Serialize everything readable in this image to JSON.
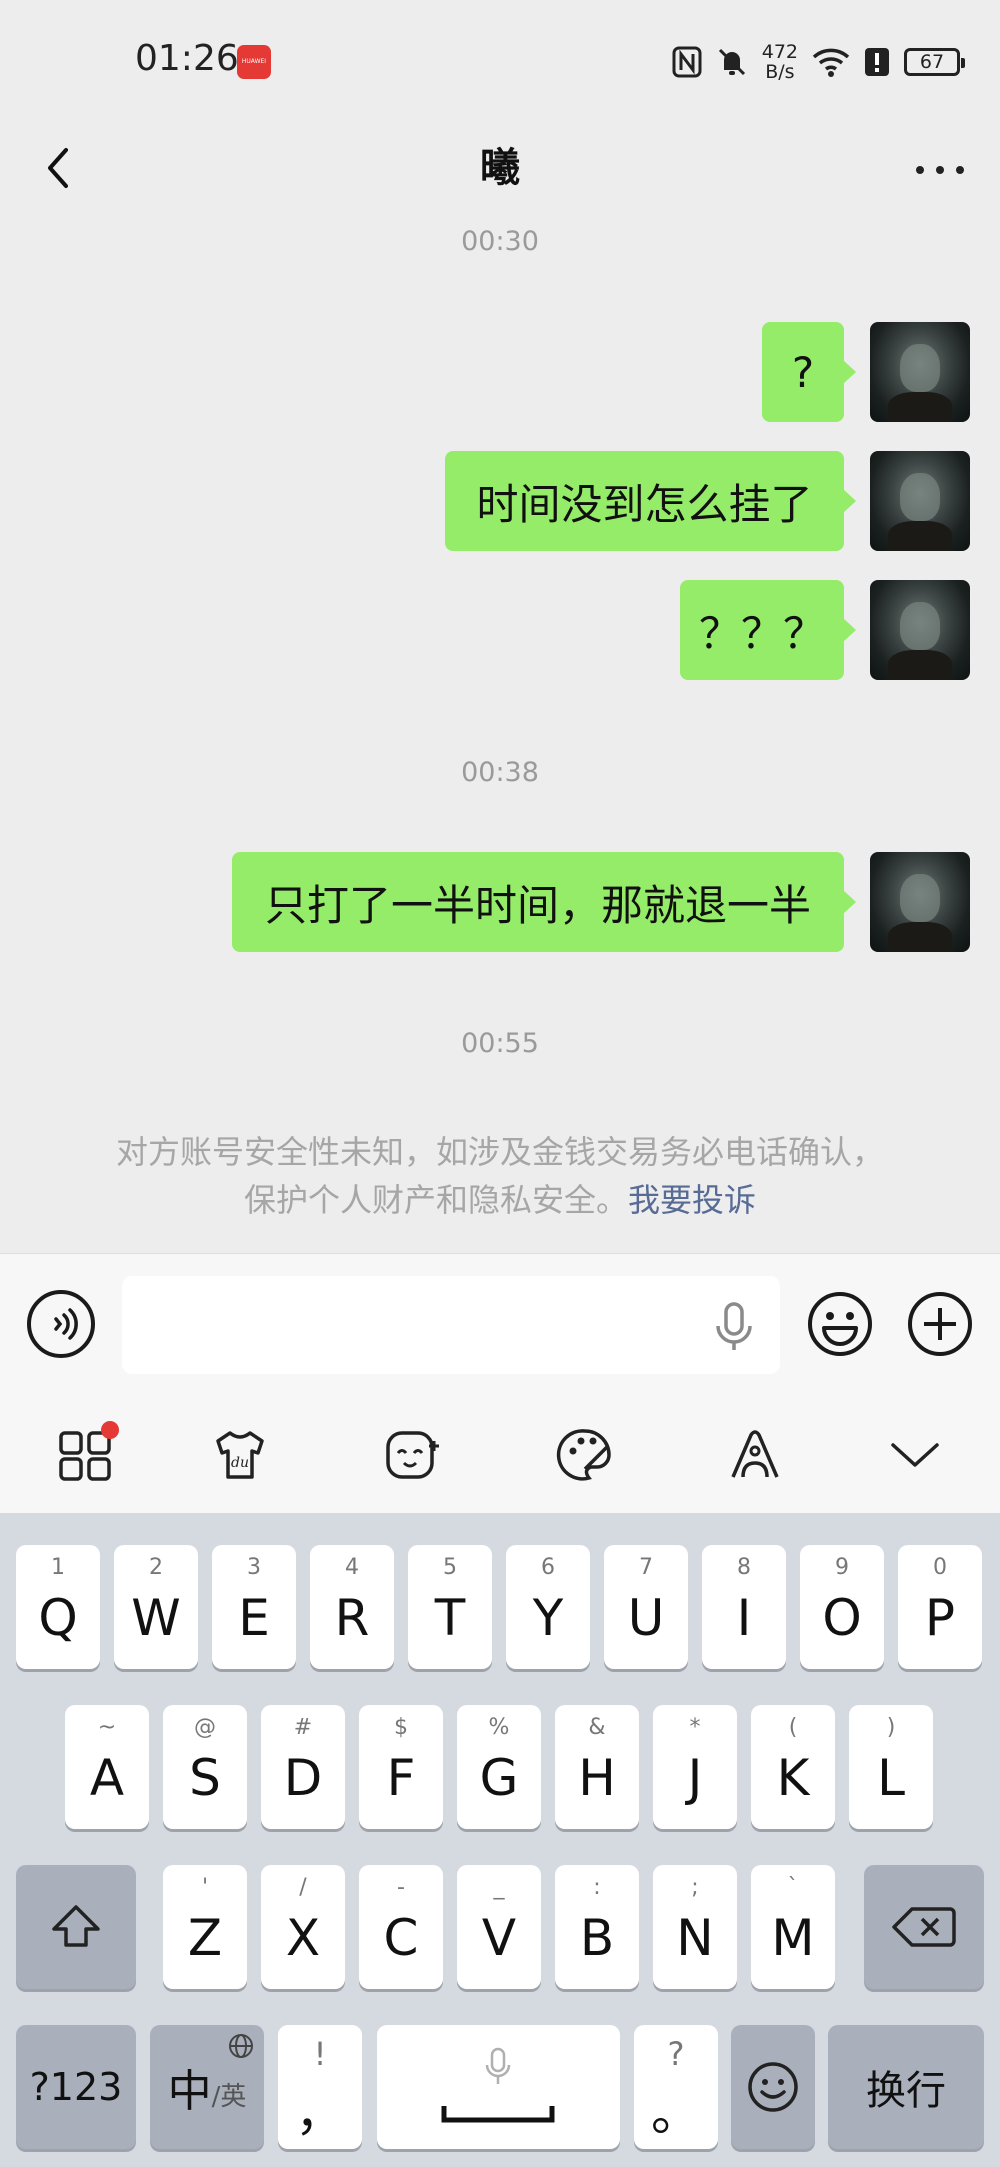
{
  "status_bar": {
    "time": "01:26",
    "app_icon_text": "HUAWEI",
    "net_speed_value": "472",
    "net_speed_unit": "B/s",
    "battery": "67"
  },
  "nav": {
    "title": "曦"
  },
  "messages": [
    {
      "type": "timestamp",
      "text": "00:30"
    },
    {
      "type": "sent",
      "text": "?"
    },
    {
      "type": "sent",
      "text": "时间没到怎么挂了"
    },
    {
      "type": "sent",
      "text": "？？？"
    },
    {
      "type": "timestamp",
      "text": "00:38"
    },
    {
      "type": "sent",
      "text": "只打了一半时间，那就退一半"
    },
    {
      "type": "timestamp",
      "text": "00:55"
    }
  ],
  "notice": {
    "line1": "对方账号安全性未知，如涉及金钱交易务必电话确认，",
    "line2": "保护个人财产和隐私安全。",
    "link": "我要投诉"
  },
  "input": {
    "placeholder": ""
  },
  "keyboard": {
    "row1": [
      {
        "hint": "1",
        "label": "Q"
      },
      {
        "hint": "2",
        "label": "W"
      },
      {
        "hint": "3",
        "label": "E"
      },
      {
        "hint": "4",
        "label": "R"
      },
      {
        "hint": "5",
        "label": "T"
      },
      {
        "hint": "6",
        "label": "Y"
      },
      {
        "hint": "7",
        "label": "U"
      },
      {
        "hint": "8",
        "label": "I"
      },
      {
        "hint": "9",
        "label": "O"
      },
      {
        "hint": "0",
        "label": "P"
      }
    ],
    "row2": [
      {
        "hint": "~",
        "label": "A"
      },
      {
        "hint": "@",
        "label": "S"
      },
      {
        "hint": "#",
        "label": "D"
      },
      {
        "hint": "$",
        "label": "F"
      },
      {
        "hint": "%",
        "label": "G"
      },
      {
        "hint": "&",
        "label": "H"
      },
      {
        "hint": "*",
        "label": "J"
      },
      {
        "hint": "(",
        "label": "K"
      },
      {
        "hint": ")",
        "label": "L"
      }
    ],
    "row3": [
      {
        "hint": "'",
        "label": "Z"
      },
      {
        "hint": "/",
        "label": "X"
      },
      {
        "hint": "-",
        "label": "C"
      },
      {
        "hint": "_",
        "label": "V"
      },
      {
        "hint": ":",
        "label": "B"
      },
      {
        "hint": ";",
        "label": "N"
      },
      {
        "hint": "`",
        "label": "M"
      }
    ],
    "numbers_key": "?123",
    "lang_key_main": "中",
    "lang_key_sub": "/英",
    "comma_hint": "!",
    "comma_key": "，",
    "period_hint": "?",
    "period_key": "。",
    "enter_key": "换行"
  }
}
